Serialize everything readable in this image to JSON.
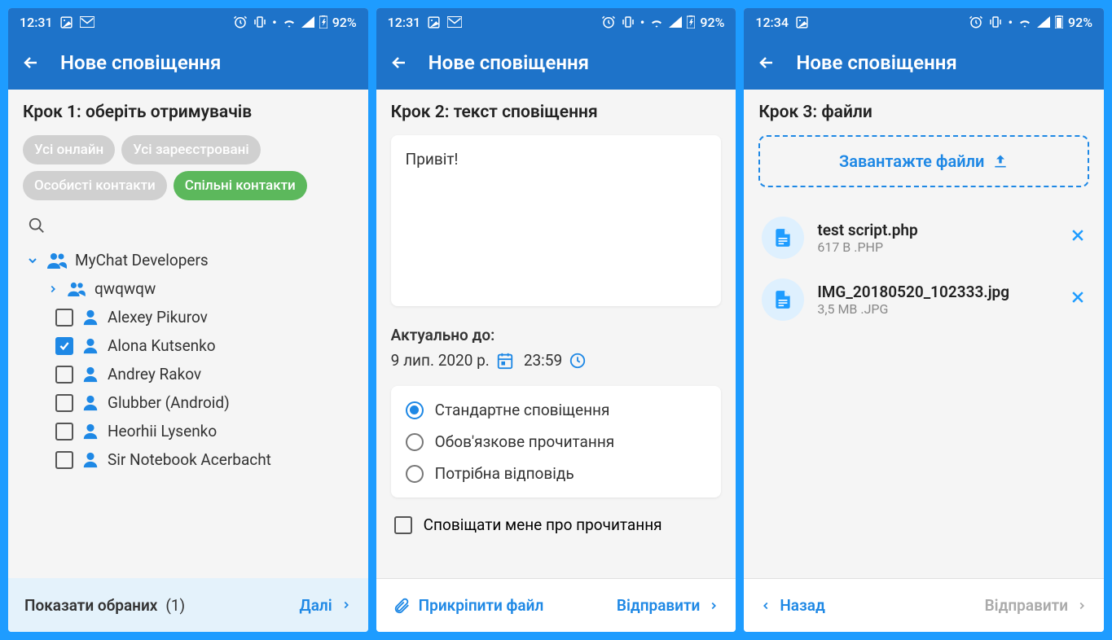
{
  "status": {
    "time1": "12:31",
    "time2": "12:31",
    "time3": "12:34",
    "battery": "92%"
  },
  "app_title": "Нове сповіщення",
  "screen1": {
    "step_title": "Крок 1: оберіть отримувачів",
    "chips": [
      "Усі онлайн",
      "Усі зареєстровані",
      "Особисті контакти",
      "Спільні контакти"
    ],
    "group": "MyChat Developers",
    "subgroup": "qwqwqw",
    "contacts": [
      {
        "name": "Alexey Pikurov",
        "checked": false
      },
      {
        "name": "Alona Kutsenko",
        "checked": true
      },
      {
        "name": "Andrey Rakov",
        "checked": false
      },
      {
        "name": "Glubber (Android)",
        "checked": false
      },
      {
        "name": "Heorhii Lysenko",
        "checked": false
      },
      {
        "name": "Sir Notebook Acerbacht",
        "checked": false
      }
    ],
    "footer_label": "Показати обраних",
    "footer_count": "(1)",
    "footer_next": "Далі"
  },
  "screen2": {
    "step_title": "Крок 2: текст сповіщення",
    "message": "Привіт!",
    "valid_until_label": "Актуально до:",
    "date": "9 лип. 2020 р.",
    "time": "23:59",
    "radio": [
      "Стандартне сповіщення",
      "Обов'язкове прочитання",
      "Потрібна відповідь"
    ],
    "notify_label": "Сповіщати мене про прочитання",
    "footer_attach": "Прикріпити файл",
    "footer_send": "Відправити"
  },
  "screen3": {
    "step_title": "Крок 3: файли",
    "upload_label": "Завантажте файли",
    "files": [
      {
        "name": "test script.php",
        "meta": "617 B .PHP"
      },
      {
        "name": "IMG_20180520_102333.jpg",
        "meta": "3,5 MB .JPG"
      }
    ],
    "footer_back": "Назад",
    "footer_send": "Відправити"
  }
}
